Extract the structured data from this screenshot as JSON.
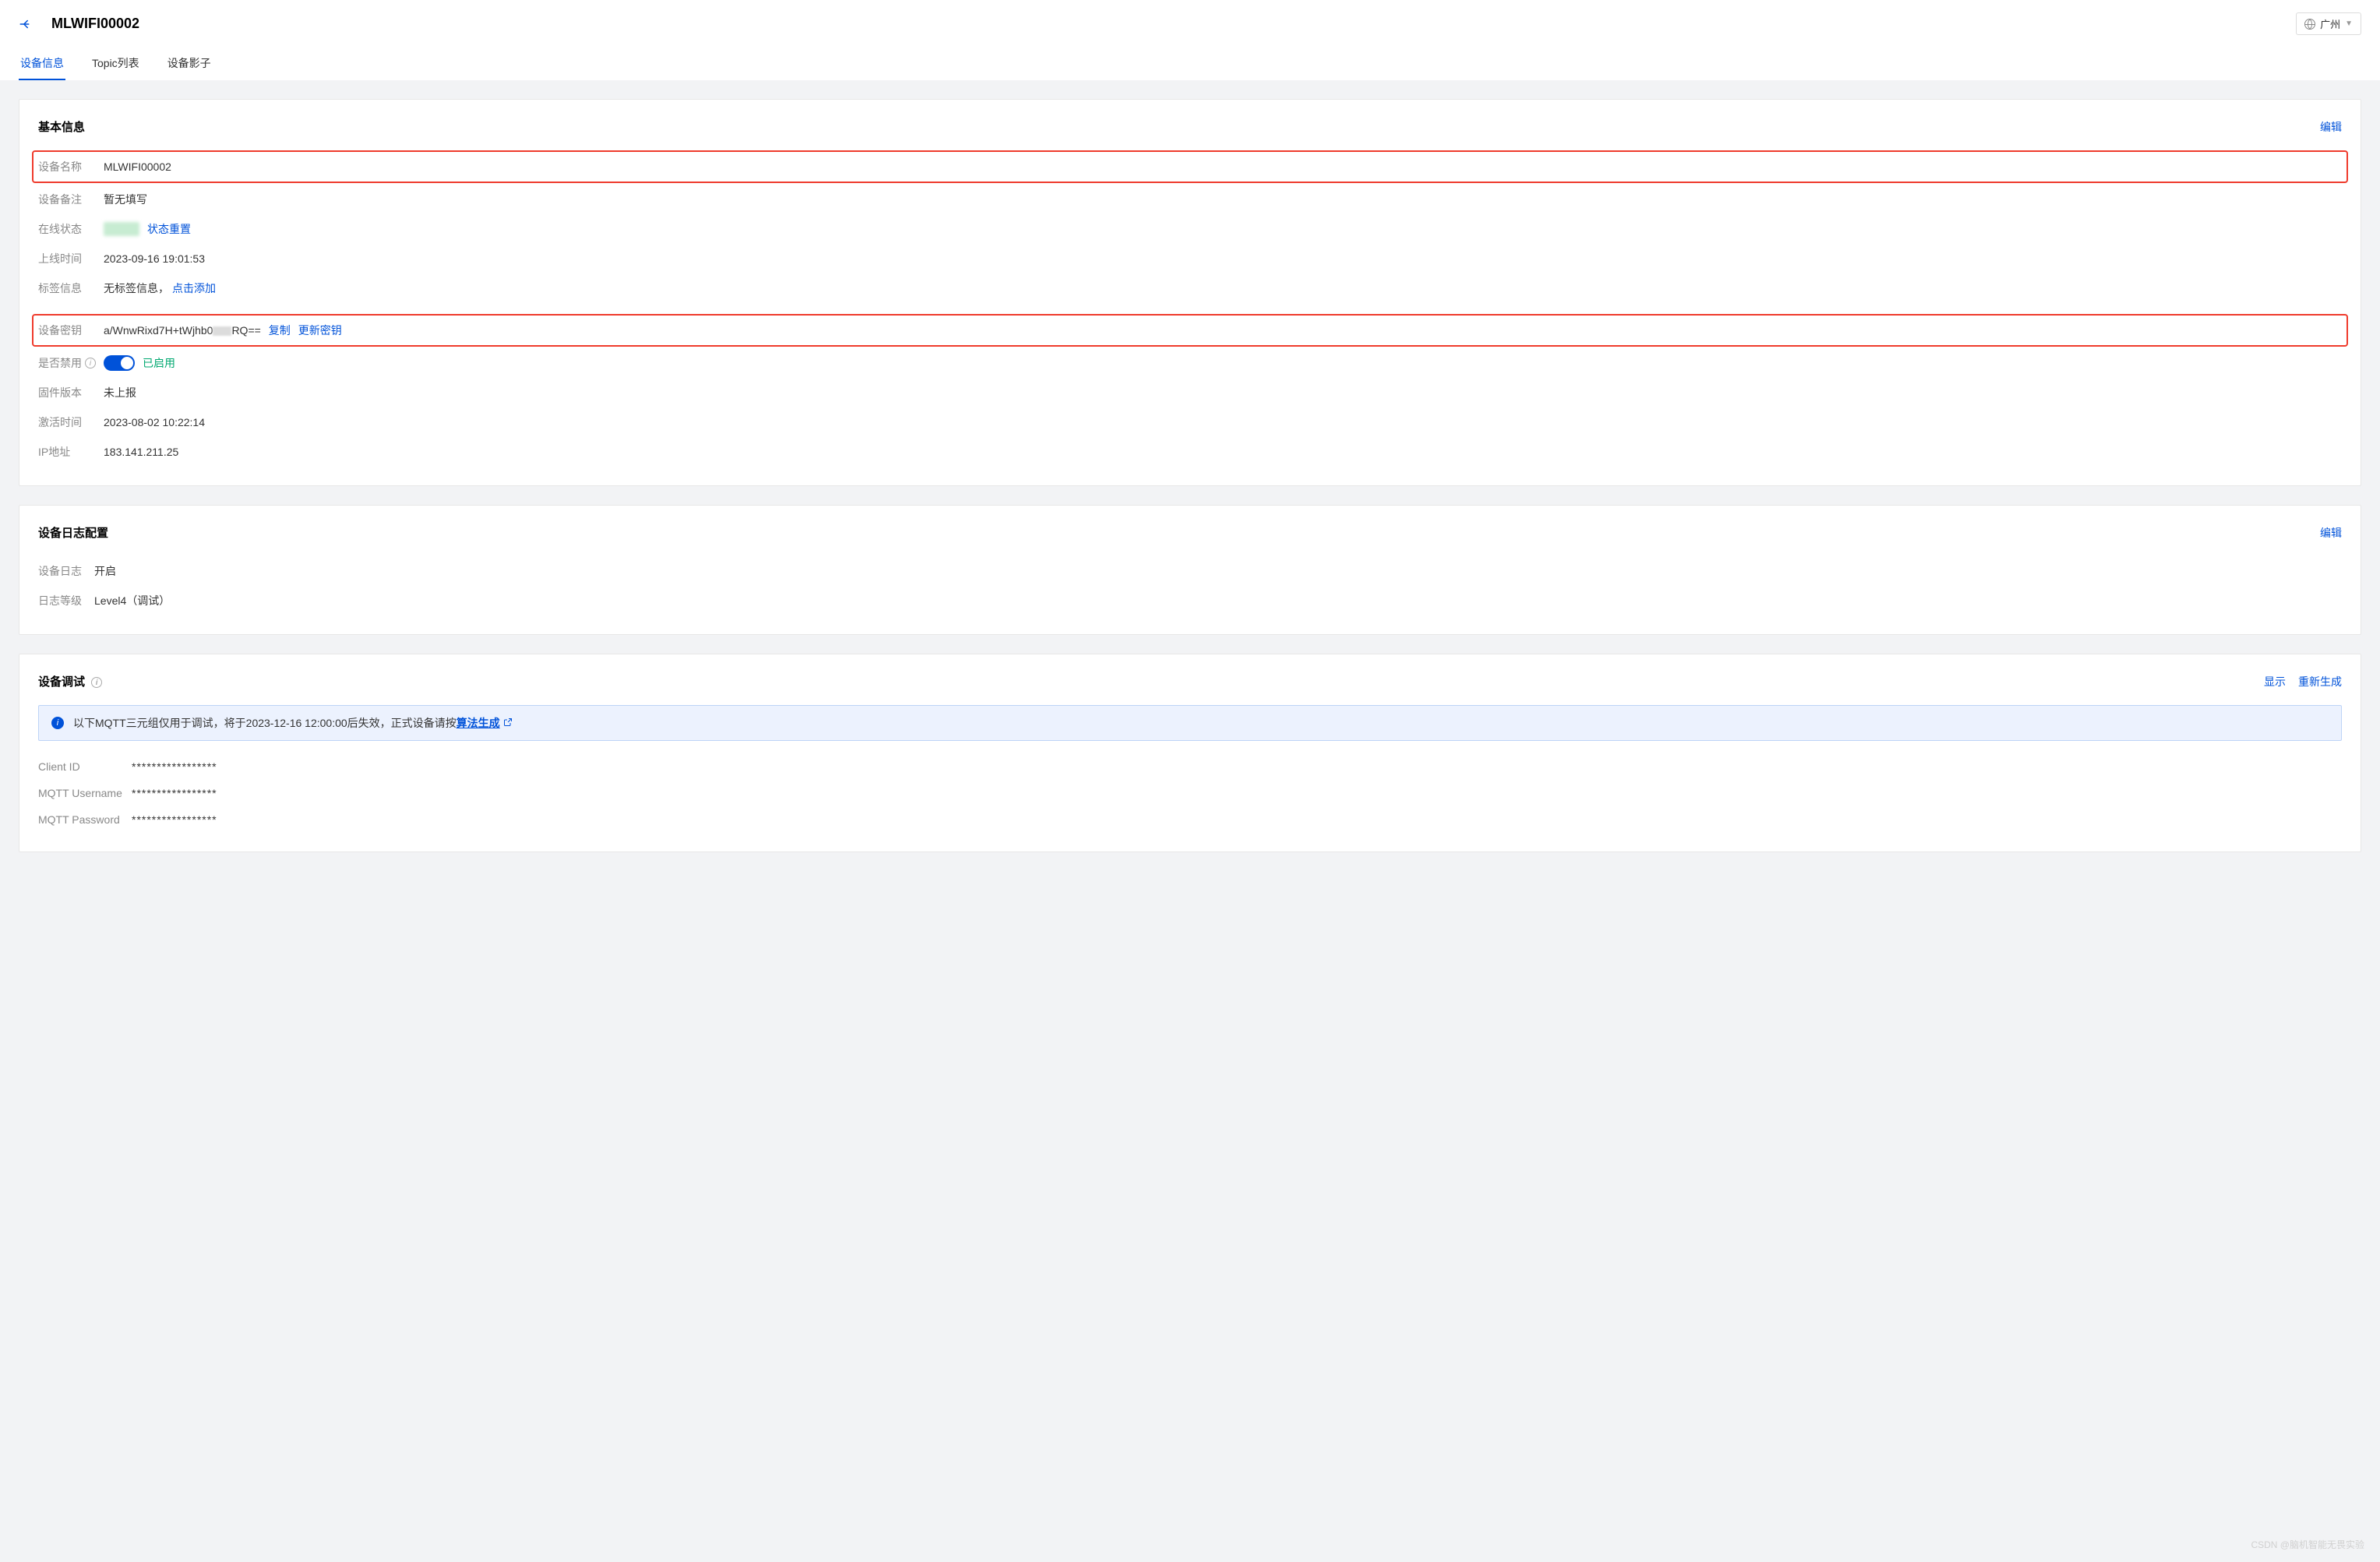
{
  "header": {
    "title": "MLWIFI00002",
    "region": "广州"
  },
  "tabs": [
    {
      "label": "设备信息",
      "active": true
    },
    {
      "label": "Topic列表",
      "active": false
    },
    {
      "label": "设备影子",
      "active": false
    }
  ],
  "basic": {
    "title": "基本信息",
    "edit": "编辑",
    "fields": {
      "device_name_label": "设备名称",
      "device_name_value": "MLWIFI00002",
      "device_remark_label": "设备备注",
      "device_remark_value": "暂无填写",
      "online_status_label": "在线状态",
      "status_reset": "状态重置",
      "online_time_label": "上线时间",
      "online_time_value": "2023-09-16 19:01:53",
      "tags_label": "标签信息",
      "tags_value": "无标签信息，",
      "tags_add": "点击添加",
      "device_key_label": "设备密钥",
      "device_key_prefix": "a/WnwRixd7H+tWjhb0",
      "device_key_suffix": "RQ==",
      "copy": "复制",
      "update_key": "更新密钥",
      "disabled_label": "是否禁用",
      "enabled_value": "已启用",
      "firmware_label": "固件版本",
      "firmware_value": "未上报",
      "activate_time_label": "激活时间",
      "activate_time_value": "2023-08-02 10:22:14",
      "ip_label": "IP地址",
      "ip_value": "183.141.211.25"
    }
  },
  "log": {
    "title": "设备日志配置",
    "edit": "编辑",
    "device_log_label": "设备日志",
    "device_log_value": "开启",
    "log_level_label": "日志等级",
    "log_level_value": "Level4（调试）"
  },
  "debug": {
    "title": "设备调试",
    "show": "显示",
    "regen": "重新生成",
    "notice_prefix": "以下MQTT三元组仅用于调试，将于2023-12-16 12:00:00后失效，正式设备请按",
    "notice_link": "算法生成",
    "client_id_label": "Client ID",
    "client_id_value": "*****************",
    "mqtt_user_label": "MQTT Username",
    "mqtt_user_value": "*****************",
    "mqtt_pass_label": "MQTT Password",
    "mqtt_pass_value": "*****************"
  },
  "watermark": "CSDN @脑机智能无畏实验"
}
